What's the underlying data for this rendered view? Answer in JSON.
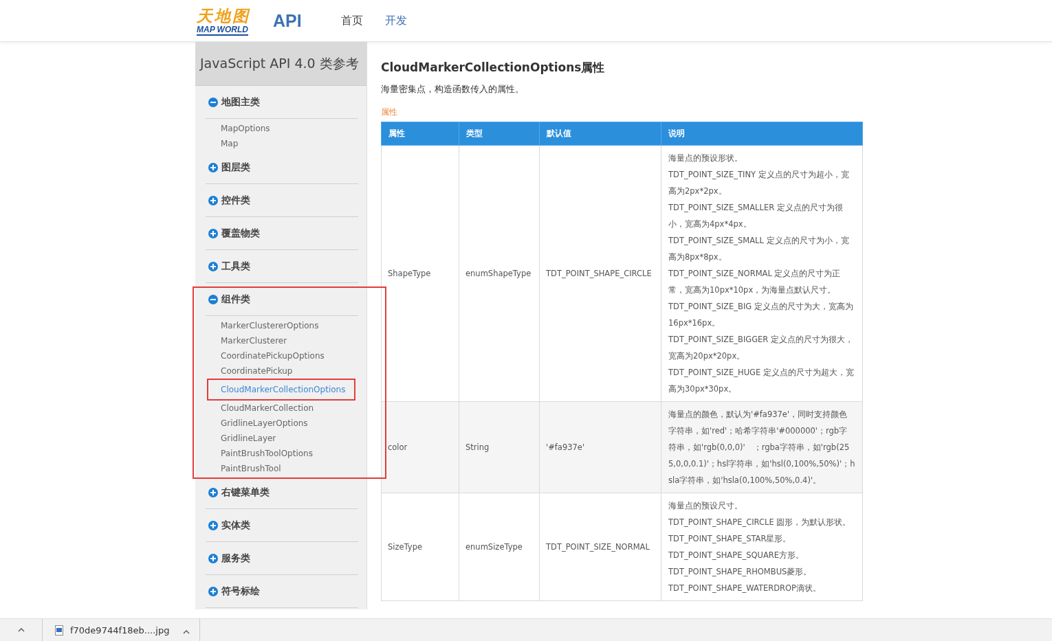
{
  "header": {
    "logo": {
      "cn": "天地图",
      "en": "MAP WORLD"
    },
    "product": "API",
    "nav": [
      {
        "label": "首页",
        "selected": false
      },
      {
        "label": "开发",
        "selected": true
      }
    ]
  },
  "sidebar": {
    "title": "JavaScript API 4.0 类参考",
    "groups": [
      {
        "label": "地图主类",
        "expanded": true,
        "annotated": false,
        "items": [
          {
            "label": "MapOptions",
            "selected": false,
            "annotated": false
          },
          {
            "label": "Map",
            "selected": false,
            "annotated": false
          }
        ]
      },
      {
        "label": "图层类",
        "expanded": false,
        "annotated": false
      },
      {
        "label": "控件类",
        "expanded": false,
        "annotated": false
      },
      {
        "label": "覆盖物类",
        "expanded": false,
        "annotated": false
      },
      {
        "label": "工具类",
        "expanded": false,
        "annotated": false
      },
      {
        "label": "组件类",
        "expanded": true,
        "annotated": true,
        "items": [
          {
            "label": "MarkerClustererOptions",
            "selected": false,
            "annotated": false
          },
          {
            "label": "MarkerClusterer",
            "selected": false,
            "annotated": false
          },
          {
            "label": "CoordinatePickupOptions",
            "selected": false,
            "annotated": false
          },
          {
            "label": "CoordinatePickup",
            "selected": false,
            "annotated": false
          },
          {
            "label": "CloudMarkerCollectionOptions",
            "selected": true,
            "annotated": true
          },
          {
            "label": "CloudMarkerCollection",
            "selected": false,
            "annotated": false
          },
          {
            "label": "GridlineLayerOptions",
            "selected": false,
            "annotated": false
          },
          {
            "label": "GridlineLayer",
            "selected": false,
            "annotated": false
          },
          {
            "label": "PaintBrushToolOptions",
            "selected": false,
            "annotated": false
          },
          {
            "label": "PaintBrushTool",
            "selected": false,
            "annotated": false
          }
        ]
      },
      {
        "label": "右键菜单类",
        "expanded": false,
        "annotated": false
      },
      {
        "label": "实体类",
        "expanded": false,
        "annotated": false
      },
      {
        "label": "服务类",
        "expanded": false,
        "annotated": false
      },
      {
        "label": "符号标绘",
        "expanded": false,
        "annotated": false
      }
    ]
  },
  "content": {
    "title": "CloudMarkerCollectionOptions属性",
    "description": "海量密集点，构造函数传入的属性。",
    "section": "属性",
    "table": {
      "columns": [
        "属性",
        "类型",
        "默认值",
        "说明"
      ],
      "rows": [
        {
          "name": "ShapeType",
          "type": "enumShapeType",
          "default": "TDT_POINT_SHAPE_CIRCLE",
          "description": [
            "海量点的预设形状。",
            "TDT_POINT_SIZE_TINY 定义点的尺寸为超小，宽高为2px*2px。",
            "TDT_POINT_SIZE_SMALLER 定义点的尺寸为很小，宽高为4px*4px。",
            "TDT_POINT_SIZE_SMALL 定义点的尺寸为小，宽高为8px*8px。",
            "TDT_POINT_SIZE_NORMAL 定义点的尺寸为正常，宽高为10px*10px，为海量点默认尺寸。",
            "TDT_POINT_SIZE_BIG 定义点的尺寸为大，宽高为16px*16px。",
            "TDT_POINT_SIZE_BIGGER 定义点的尺寸为很大，宽高为20px*20px。",
            "TDT_POINT_SIZE_HUGE 定义点的尺寸为超大，宽高为30px*30px。"
          ]
        },
        {
          "name": "color",
          "type": "String",
          "default": "'#fa937e'",
          "description": [
            "海量点的颜色，默认为'#fa937e'，同时支持颜色字符串，如'red'；哈希字符串'#000000'；rgb字符串，如'rgb(0,0,0)'　；rgba字符串，如'rgb(255,0,0,0.1)'；hsl字符串，如'hsl(0,100%,50%)'；hsla字符串，如'hsla(0,100%,50%,0.4)'。"
          ]
        },
        {
          "name": "SizeType",
          "type": "enumSizeType",
          "default": "TDT_POINT_SIZE_NORMAL",
          "description": [
            "海量点的预设尺寸。",
            "TDT_POINT_SHAPE_CIRCLE 圆形，为默认形状。",
            "TDT_POINT_SHAPE_STAR星形。",
            "TDT_POINT_SHAPE_SQUARE方形。",
            "TDT_POINT_SHAPE_RHOMBUS菱形。",
            "TDT_POINT_SHAPE_WATERDROP滴状。"
          ]
        }
      ]
    }
  },
  "download_bar": {
    "file": "f70de9744f18eb....jpg"
  }
}
